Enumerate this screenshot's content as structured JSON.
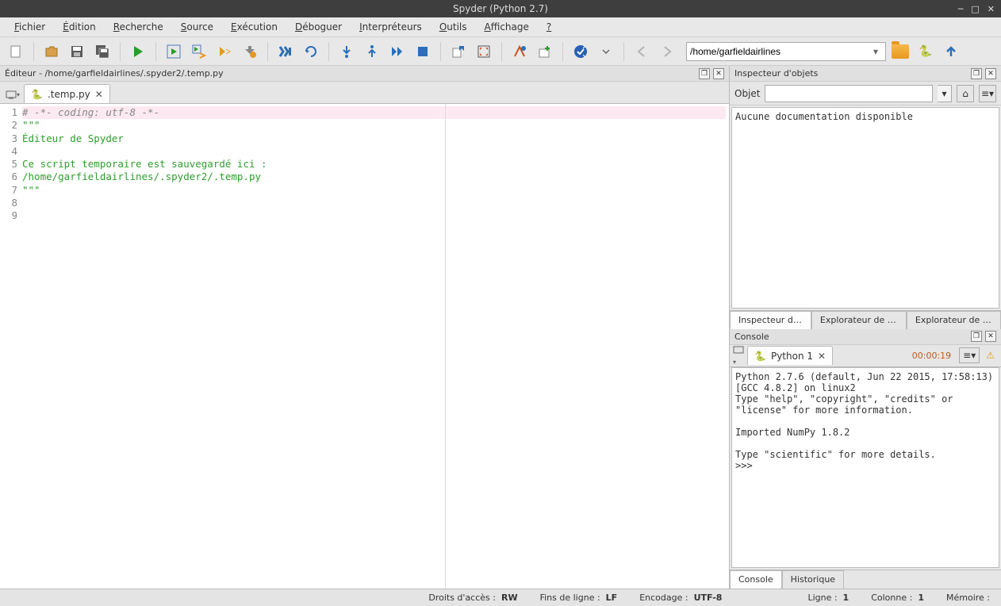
{
  "window": {
    "title": "Spyder (Python 2.7)"
  },
  "menu": [
    "Fichier",
    "Édition",
    "Recherche",
    "Source",
    "Exécution",
    "Déboguer",
    "Interpréteurs",
    "Outils",
    "Affichage",
    "?"
  ],
  "toolbar": {
    "path": "/home/garfieldairlines"
  },
  "editor": {
    "pane_title": "Éditeur - /home/garfieldairlines/.spyder2/.temp.py",
    "tab": ".temp.py",
    "lines": [
      {
        "n": 1,
        "txt": "# -*- coding: utf-8 -*-",
        "cls": "cm",
        "hl": true
      },
      {
        "n": 2,
        "txt": "\"\"\"",
        "cls": "str"
      },
      {
        "n": 3,
        "txt": "Éditeur de Spyder",
        "cls": "str"
      },
      {
        "n": 4,
        "txt": "",
        "cls": "str"
      },
      {
        "n": 5,
        "txt": "Ce script temporaire est sauvegardé ici :",
        "cls": "str"
      },
      {
        "n": 6,
        "txt": "/home/garfieldairlines/.spyder2/.temp.py",
        "cls": "str"
      },
      {
        "n": 7,
        "txt": "\"\"\"",
        "cls": "str"
      },
      {
        "n": 8,
        "txt": "",
        "cls": ""
      },
      {
        "n": 9,
        "txt": "",
        "cls": ""
      }
    ]
  },
  "inspector": {
    "pane_title": "Inspecteur d'objets",
    "object_label": "Objet",
    "doc": "Aucune documentation disponible",
    "tabs": [
      "Inspecteur d'ob...",
      "Explorateur de varia...",
      "Explorateur de fich..."
    ]
  },
  "console": {
    "pane_title": "Console",
    "tab": "Python 1",
    "timer": "00:00:19",
    "output": "Python 2.7.6 (default, Jun 22 2015, 17:58:13) \n[GCC 4.8.2] on linux2\nType \"help\", \"copyright\", \"credits\" or \"license\" for more information.\n\nImported NumPy 1.8.2\n\nType \"scientific\" for more details.\n>>> ",
    "tabs": [
      "Console",
      "Historique"
    ]
  },
  "status": {
    "droits_label": "Droits d'accès :",
    "droits": "RW",
    "fins_label": "Fins de ligne :",
    "fins": "LF",
    "enc_label": "Encodage :",
    "enc": "UTF-8",
    "ligne_label": "Ligne :",
    "ligne": "1",
    "col_label": "Colonne :",
    "col": "1",
    "mem_label": "Mémoire :"
  }
}
